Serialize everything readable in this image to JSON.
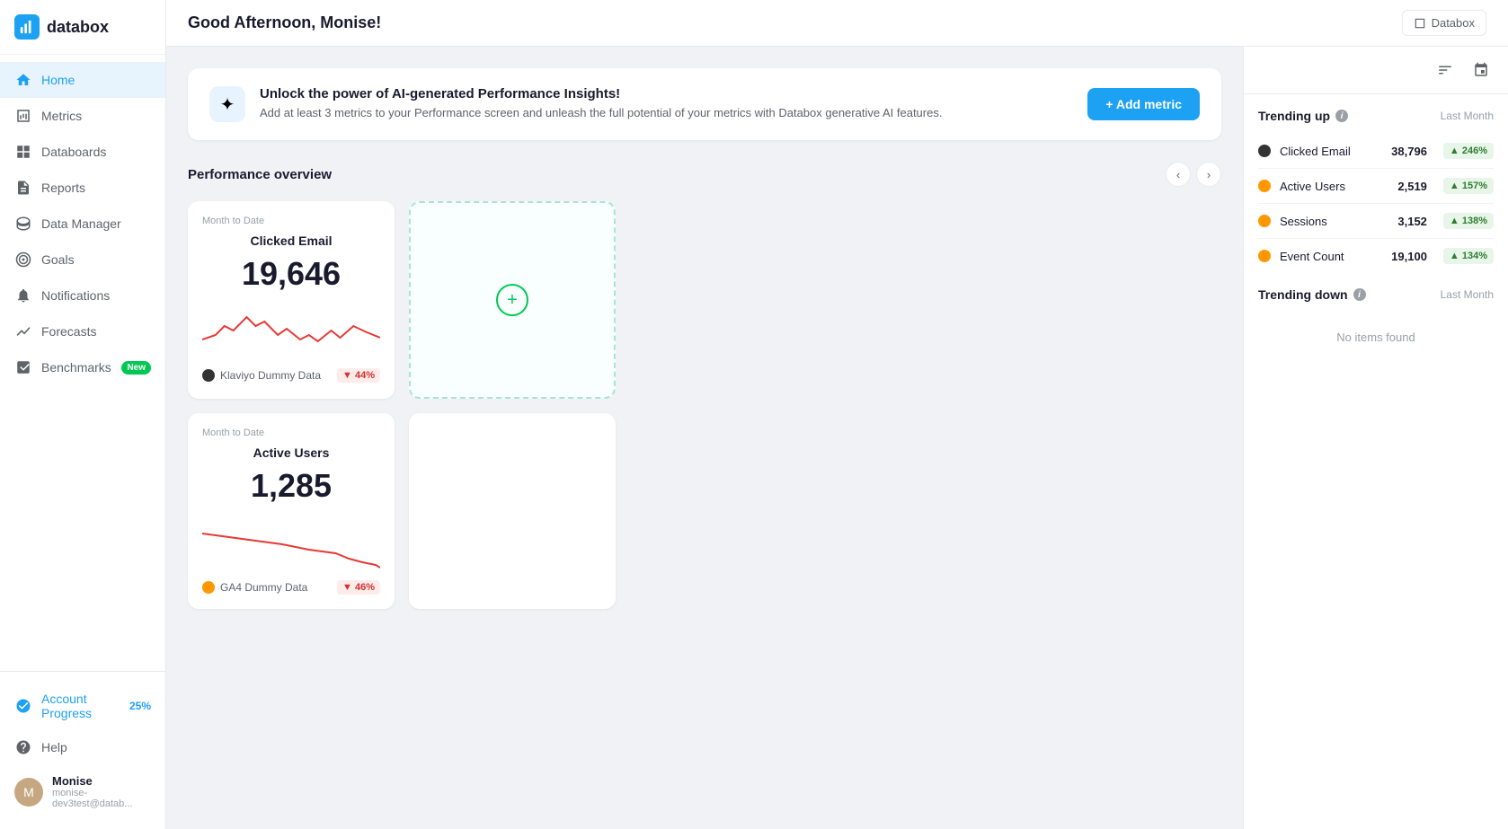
{
  "app": {
    "name": "databox",
    "logo_text": "databox"
  },
  "header": {
    "greeting": "Good Afternoon, Monise!",
    "databox_label": "Databox"
  },
  "sidebar": {
    "nav_items": [
      {
        "id": "home",
        "label": "Home",
        "icon": "home-icon",
        "active": true
      },
      {
        "id": "metrics",
        "label": "Metrics",
        "icon": "metrics-icon",
        "active": false
      },
      {
        "id": "databoards",
        "label": "Databoards",
        "icon": "databoards-icon",
        "active": false
      },
      {
        "id": "reports",
        "label": "Reports",
        "icon": "reports-icon",
        "active": false
      },
      {
        "id": "data-manager",
        "label": "Data Manager",
        "icon": "data-manager-icon",
        "active": false
      },
      {
        "id": "goals",
        "label": "Goals",
        "icon": "goals-icon",
        "active": false
      },
      {
        "id": "notifications",
        "label": "Notifications",
        "icon": "notifications-icon",
        "active": false
      },
      {
        "id": "forecasts",
        "label": "Forecasts",
        "icon": "forecasts-icon",
        "active": false
      },
      {
        "id": "benchmarks",
        "label": "Benchmarks",
        "icon": "benchmarks-icon",
        "active": false,
        "badge": "New"
      }
    ],
    "bottom": {
      "account_progress_label": "Account Progress",
      "account_progress_pct": "25%",
      "help_label": "Help",
      "user_name": "Monise",
      "user_email": "monise-dev3test@datab..."
    }
  },
  "ai_banner": {
    "icon": "✦",
    "title": "Unlock the power of AI-generated Performance Insights!",
    "description": "Add at least 3 metrics to your Performance screen and unleash the full potential of your metrics with Databox generative AI features.",
    "add_metric_label": "+ Add metric"
  },
  "performance_overview": {
    "title": "Performance overview",
    "cards": [
      {
        "id": "clicked-email",
        "period": "Month to Date",
        "title": "Clicked Email",
        "value": "19,646",
        "source": "Klaviyo Dummy Data",
        "source_type": "dark",
        "change": "▼ 44%",
        "change_type": "down"
      },
      {
        "id": "active-users",
        "period": "Month to Date",
        "title": "Active Users",
        "value": "1,285",
        "source": "GA4 Dummy Data",
        "source_type": "orange",
        "change": "▼ 46%",
        "change_type": "down"
      }
    ]
  },
  "trending_up": {
    "title": "Trending up",
    "period": "Last Month",
    "items": [
      {
        "name": "Clicked Email",
        "value": "38,796",
        "change": "▲ 246%",
        "dot": "dark"
      },
      {
        "name": "Active Users",
        "value": "2,519",
        "change": "▲ 157%",
        "dot": "orange"
      },
      {
        "name": "Sessions",
        "value": "3,152",
        "change": "▲ 138%",
        "dot": "orange"
      },
      {
        "name": "Event Count",
        "value": "19,100",
        "change": "▲ 134%",
        "dot": "orange"
      }
    ]
  },
  "trending_down": {
    "title": "Trending down",
    "period": "Last Month",
    "no_items_text": "No items found"
  }
}
